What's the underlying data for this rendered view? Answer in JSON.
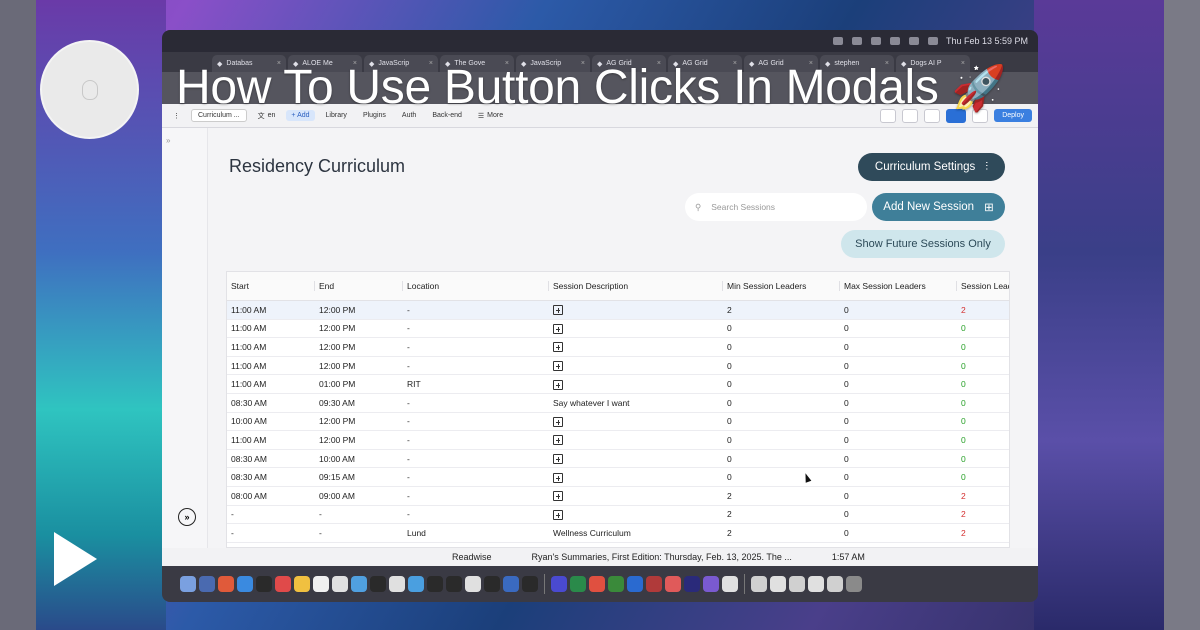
{
  "video_title": "How To Use Button Clicks In Modals",
  "title_emoji": "🚀",
  "mac_topbar": {
    "clock": "Thu Feb 13  5:59 PM"
  },
  "browser_tabs": [
    {
      "label": "Databas"
    },
    {
      "label": "ALOE Me"
    },
    {
      "label": "JavaScrip"
    },
    {
      "label": "The Gove"
    },
    {
      "label": "JavaScrip"
    },
    {
      "label": "AG Grid"
    },
    {
      "label": "AG Grid"
    },
    {
      "label": "AG Grid"
    },
    {
      "label": "stephen"
    },
    {
      "label": "Dogs AI P"
    }
  ],
  "builder_toolbar": {
    "page_select": "Curriculum ...",
    "lang": "en",
    "add": "+ Add",
    "library": "Library",
    "plugins": "Plugins",
    "auth": "Auth",
    "backend": "Back-end",
    "more": "More",
    "deploy": "Deploy"
  },
  "page": {
    "title": "Residency Curriculum",
    "settings_button": "Curriculum Settings",
    "add_button": "Add New Session",
    "search_placeholder": "Search Sessions",
    "future_button": "Show Future Sessions Only"
  },
  "grid": {
    "columns": [
      "Start",
      "End",
      "Location",
      "Session Description",
      "Min Session Leaders",
      "Max Session Leaders",
      "Session Leade"
    ],
    "rows": [
      {
        "start": "11:00 AM",
        "end": "12:00 PM",
        "location": "-",
        "desc": "",
        "min": "2",
        "max": "0",
        "leaders": "2",
        "status": "red"
      },
      {
        "start": "11:00 AM",
        "end": "12:00 PM",
        "location": "-",
        "desc": "",
        "min": "0",
        "max": "0",
        "leaders": "0",
        "status": "green"
      },
      {
        "start": "11:00 AM",
        "end": "12:00 PM",
        "location": "-",
        "desc": "",
        "min": "0",
        "max": "0",
        "leaders": "0",
        "status": "green"
      },
      {
        "start": "11:00 AM",
        "end": "12:00 PM",
        "location": "-",
        "desc": "",
        "min": "0",
        "max": "0",
        "leaders": "0",
        "status": "green"
      },
      {
        "start": "11:00 AM",
        "end": "01:00 PM",
        "location": "RIT",
        "desc": "",
        "min": "0",
        "max": "0",
        "leaders": "0",
        "status": "green"
      },
      {
        "start": "08:30 AM",
        "end": "09:30 AM",
        "location": "-",
        "desc": "Say whatever I want",
        "min": "0",
        "max": "0",
        "leaders": "0",
        "status": "green"
      },
      {
        "start": "10:00 AM",
        "end": "12:00 PM",
        "location": "-",
        "desc": "",
        "min": "0",
        "max": "0",
        "leaders": "0",
        "status": "green"
      },
      {
        "start": "11:00 AM",
        "end": "12:00 PM",
        "location": "-",
        "desc": "",
        "min": "0",
        "max": "0",
        "leaders": "0",
        "status": "green"
      },
      {
        "start": "08:30 AM",
        "end": "10:00 AM",
        "location": "-",
        "desc": "",
        "min": "0",
        "max": "0",
        "leaders": "0",
        "status": "green"
      },
      {
        "start": "08:30 AM",
        "end": "09:15 AM",
        "location": "-",
        "desc": "",
        "min": "0",
        "max": "0",
        "leaders": "0",
        "status": "green"
      },
      {
        "start": "08:00 AM",
        "end": "09:00 AM",
        "location": "-",
        "desc": "",
        "min": "2",
        "max": "0",
        "leaders": "2",
        "status": "red"
      },
      {
        "start": "-",
        "end": "-",
        "location": "-",
        "desc": "",
        "min": "2",
        "max": "0",
        "leaders": "2",
        "status": "red"
      },
      {
        "start": "-",
        "end": "-",
        "location": "Lund",
        "desc": "Wellness Curriculum",
        "min": "2",
        "max": "0",
        "leaders": "2",
        "status": "red"
      }
    ]
  },
  "under_strip": {
    "app": "Readwise",
    "text": "Ryan's Summaries, First Edition: Thursday, Feb. 13, 2025. The ...",
    "time": "1:57 AM"
  },
  "colors": {
    "accent_dark": "#2f4a5a",
    "accent_teal": "#3f7f99",
    "future_bg": "#cfe6ec",
    "bad": "#d43030",
    "good": "#28a028"
  }
}
